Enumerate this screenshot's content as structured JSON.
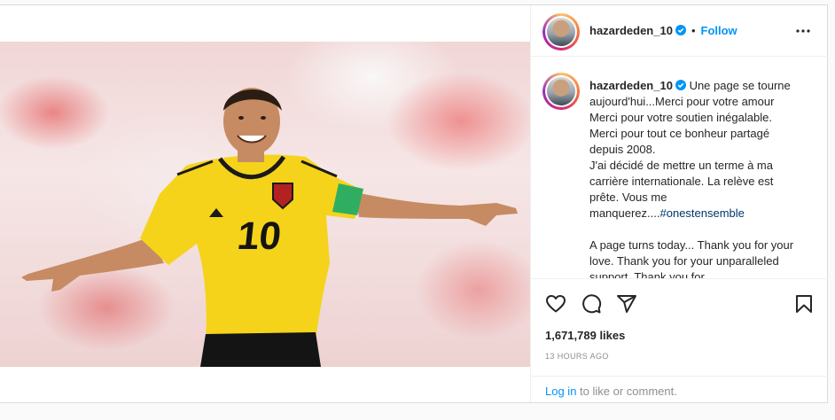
{
  "post": {
    "username": "hazardeden_10",
    "follow_label": "Follow",
    "separator": "•",
    "caption": "Une page se tourne aujourd'hui...Merci pour votre amour\nMerci pour votre soutien inégalable.\nMerci pour tout ce bonheur partagé depuis 2008.\nJ'ai décidé de mettre un terme à ma carrière internationale. La relève est prête. Vous me manquerez....",
    "hashtag": "#onestensemble",
    "caption_en": "\n\nA page turns today... Thank you for your love. Thank you for your unparalleled support. Thank you for",
    "likes": "1,671,789 likes",
    "time": "13 HOURS AGO",
    "login_link": "Log in",
    "login_rest": " to like or comment.",
    "jersey_number": "10"
  },
  "icons": {
    "verified": "verified-badge-icon",
    "more": "more-options-icon",
    "like": "heart-icon",
    "comment": "comment-icon",
    "share": "share-icon",
    "save": "bookmark-icon"
  },
  "colors": {
    "accent": "#0095f6",
    "hashtag": "#00376b",
    "muted": "#8e8e8e",
    "jersey": "#f5d31a"
  }
}
